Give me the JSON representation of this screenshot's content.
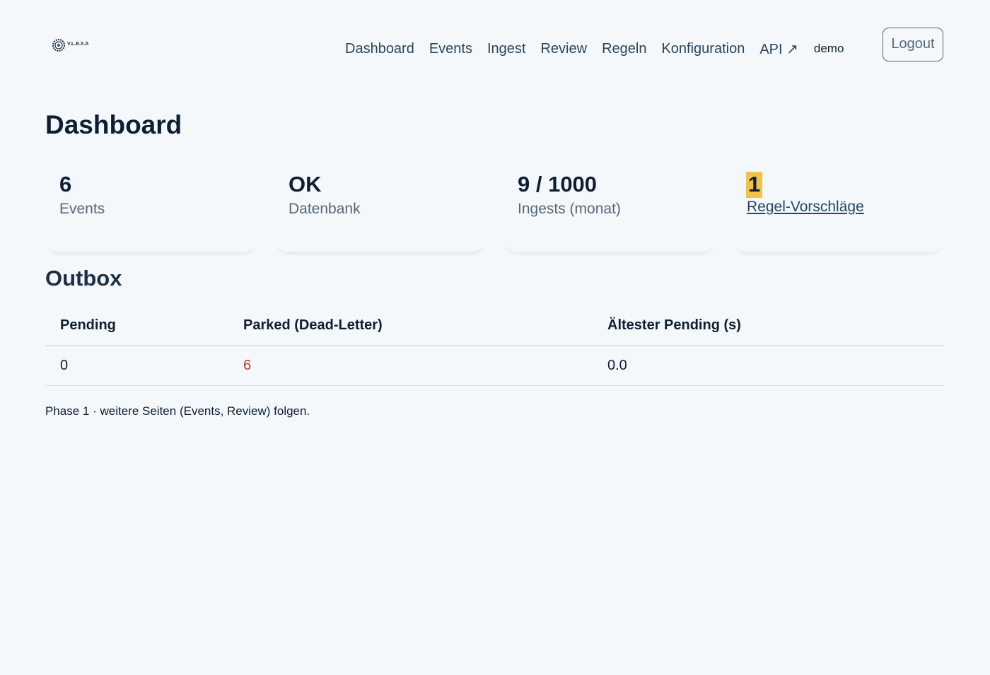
{
  "app": {
    "logo_text": "V.L.E.X.A",
    "logo_sub": "..."
  },
  "nav": {
    "items": [
      {
        "label": "Dashboard"
      },
      {
        "label": "Events"
      },
      {
        "label": "Ingest"
      },
      {
        "label": "Review"
      },
      {
        "label": "Regeln"
      },
      {
        "label": "Konfiguration"
      },
      {
        "label": "API ↗"
      }
    ],
    "user": "demo",
    "logout_label": "Logout"
  },
  "page": {
    "title": "Dashboard"
  },
  "cards": [
    {
      "value": "6",
      "label": "Events"
    },
    {
      "value": "OK",
      "label": "Datenbank"
    },
    {
      "value": "9 / 1000",
      "label": "Ingests (monat)"
    },
    {
      "value": "1",
      "label": "Regel-Vorschläge"
    }
  ],
  "outbox": {
    "title": "Outbox",
    "headers": [
      "Pending",
      "Parked (Dead-Letter)",
      "Ältester Pending (s)"
    ],
    "row": [
      "0",
      "6",
      "0.0"
    ]
  },
  "footnote": "Phase 1 · weitere Seiten (Events, Review) folgen.",
  "colors": {
    "background": "#f4f8fb",
    "text": "#0f1f33",
    "muted": "#56677a",
    "highlight": "#f0c24a",
    "alert": "#c0392b"
  }
}
